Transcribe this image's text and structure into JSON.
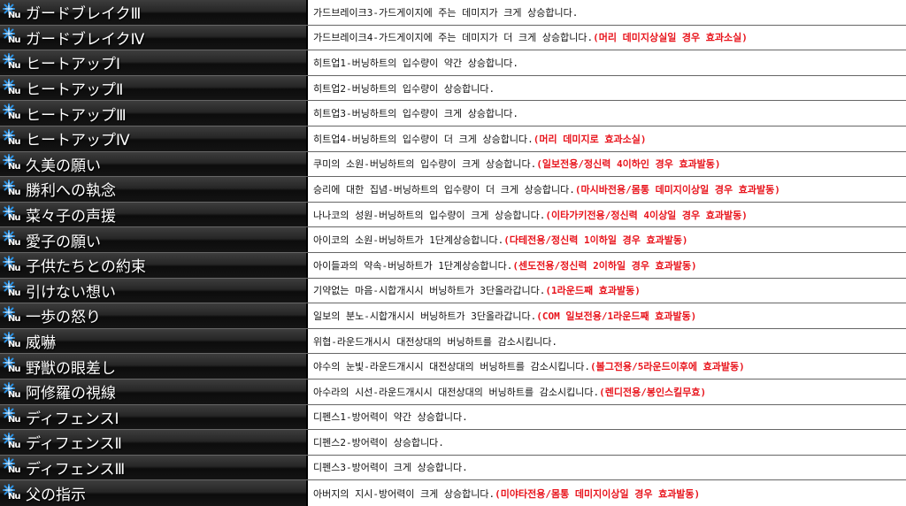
{
  "colors": {
    "note": "#e8141c",
    "name_text": "#ffffff",
    "desc_text": "#111111",
    "icon_spark": "#2a8fe0"
  },
  "icon": {
    "semantic": "nu-skill-icon",
    "label": "Nu"
  },
  "rows": [
    {
      "name": "ガードブレイクⅢ",
      "desc": "가드브레이크3-가드게이지에 주는 데미지가 크게 상승합니다.",
      "note": ""
    },
    {
      "name": "ガードブレイクⅣ",
      "desc": "가드브레이크4-가드게이지에 주는 데미지가 더 크게 상승합니다.",
      "note": "(머리 데미지상실일 경우 효과소실)"
    },
    {
      "name": "ヒートアップⅠ",
      "desc": "히트업1-버닝하트의 입수량이 약간 상승합니다.",
      "note": ""
    },
    {
      "name": "ヒートアップⅡ",
      "desc": "히트업2-버닝하트의 입수량이 상승합니다.",
      "note": ""
    },
    {
      "name": "ヒートアップⅢ",
      "desc": "히트업3-버닝하트의 입수량이 크게 상승합니다.",
      "note": ""
    },
    {
      "name": "ヒートアップⅣ",
      "desc": "히트업4-버닝하트의 입수량이 더 크게 상승합니다.",
      "note": "(머리 데미지로 효과소실)"
    },
    {
      "name": "久美の願い",
      "desc": "쿠미의 소원-버닝하트의 입수량이 크게 상승합니다.",
      "note": "(일보전용/정신력 4이하인 경우 효과발동)"
    },
    {
      "name": "勝利への執念",
      "desc": "승리에 대한 집념-버닝하트의 입수량이 더 크게 상승합니다.",
      "note": "(마시바전용/몸통 데미지이상일 경우 효과발동)"
    },
    {
      "name": "菜々子の声援",
      "desc": "나나코의 성원-버닝하트의 입수량이 크게 상승합니다.",
      "note": "(이타가키전용/정신력 4이상일 경우 효과발동)"
    },
    {
      "name": "愛子の願い",
      "desc": "아이코의 소원-버닝하트가 1단계상승합니다.",
      "note": "(다테전용/정신력 1이하일 경우 효과발동)"
    },
    {
      "name": "子供たちとの約束",
      "desc": "아이들과의 약속-버닝하트가 1단계상승합니다.",
      "note": "(센도전용/정신력 2이하일 경우 효과발동)"
    },
    {
      "name": "引けない想い",
      "desc": "기약없는 마음-시합개시시 버닝하트가 3단올라갑니다.",
      "note": "(1라운드째 효과발동)"
    },
    {
      "name": "一歩の怒り",
      "desc": "일보의 분노-시합개시시 버닝하트가 3단올라갑니다.",
      "note": "(COM 일보전용/1라운드째 효과발동)"
    },
    {
      "name": "威嚇",
      "desc": "위협-라운드개시시 대전상대의 버닝하트를 감소시킵니다.",
      "note": ""
    },
    {
      "name": "野獣の眼差し",
      "desc": "야수의 눈빛-라운드개시시 대전상대의 버닝하트를 감소시킵니다.",
      "note": "(볼그전용/5라운드이후에 효과발동)"
    },
    {
      "name": "阿修羅の視線",
      "desc": "아수라의 시선-라운드개시시 대전상대의 버닝하트를 감소시킵니다.",
      "note": "(렌디전용/봉인스킬무효)"
    },
    {
      "name": "ディフェンスⅠ",
      "desc": "디펜스1-방어력이 약간 상승합니다.",
      "note": ""
    },
    {
      "name": "ディフェンスⅡ",
      "desc": "디펜스2-방어력이 상승합니다.",
      "note": ""
    },
    {
      "name": "ディフェンスⅢ",
      "desc": "디펜스3-방어력이 크게 상승합니다.",
      "note": ""
    },
    {
      "name": "父の指示",
      "desc": "아버지의 지시-방어력이 크게 상승합니다.",
      "note": "(미야타전용/몸통 데미지이상일 경우 효과발동)"
    }
  ]
}
